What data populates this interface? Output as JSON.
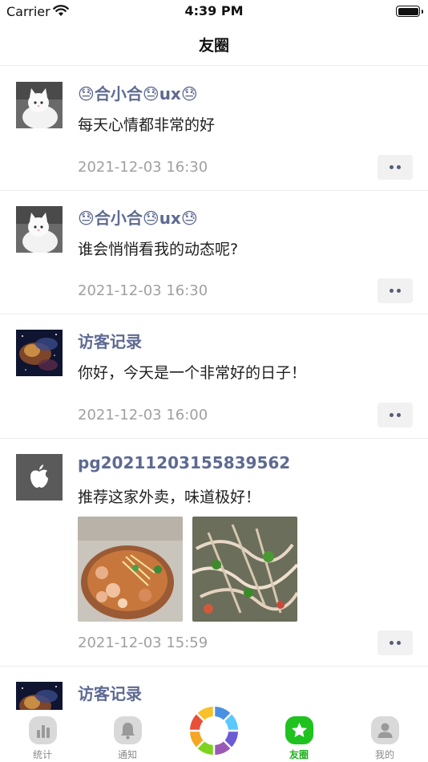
{
  "status_bar": {
    "carrier": "Carrier",
    "time": "4:39 PM"
  },
  "nav": {
    "title": "友圈"
  },
  "posts": [
    {
      "name": "😓合小合😓ux😓",
      "text": "每天心情都非常的好",
      "time": "2021-12-03 16:30",
      "avatar": "cat-avatar"
    },
    {
      "name": "😓合小合😓ux😓",
      "text": "谁会悄悄看我的动态呢?",
      "time": "2021-12-03 16:30",
      "avatar": "cat-avatar"
    },
    {
      "name": "访客记录",
      "text": "你好，今天是一个非常好的日子！",
      "time": "2021-12-03 16:00",
      "avatar": "nebula-avatar"
    },
    {
      "name": "pg20211203155839562",
      "text": "推荐这家外卖，味道极好！",
      "time": "2021-12-03 15:59",
      "avatar": "apple-logo-avatar",
      "photos": [
        "food-photo-1",
        "food-photo-2"
      ]
    },
    {
      "name": "访客记录",
      "avatar": "nebula-avatar"
    }
  ],
  "tabs": [
    {
      "label": "统计",
      "icon": "chart-icon",
      "active": false
    },
    {
      "label": "通知",
      "icon": "bell-icon",
      "active": false
    },
    {
      "label": "友圈",
      "icon": "star-icon",
      "active": true
    },
    {
      "label": "我的",
      "icon": "person-icon",
      "active": false
    }
  ],
  "colors": {
    "accent": "#1fc21f",
    "name_link": "#5e6a92",
    "timestamp": "#a0a0a0"
  }
}
